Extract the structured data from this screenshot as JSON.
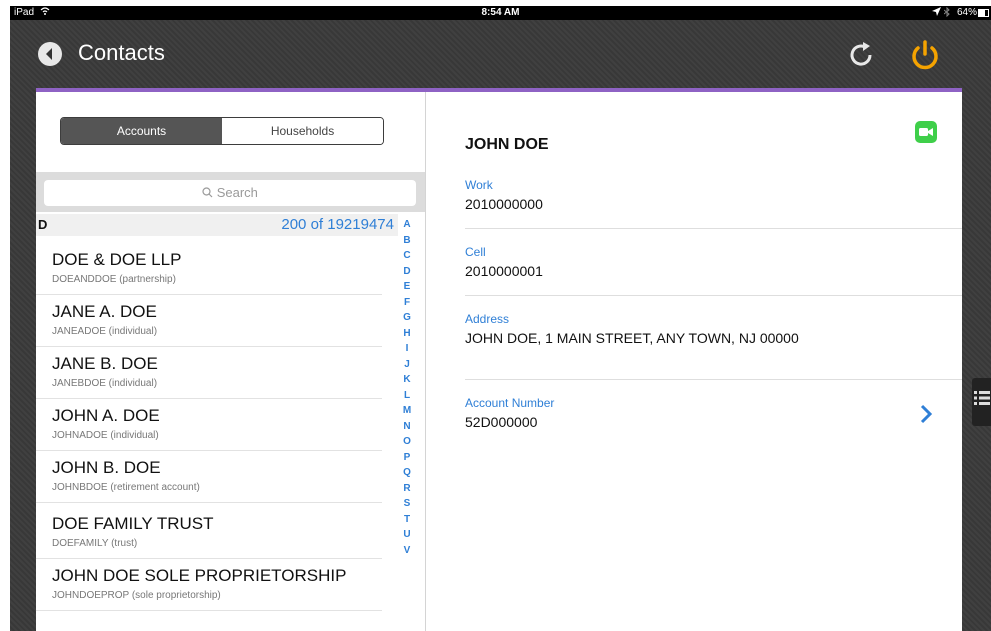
{
  "status": {
    "device": "iPad",
    "time": "8:54 AM",
    "battery": "64%",
    "battery_level": 0.64
  },
  "nav": {
    "title": "Contacts",
    "back_icon": "back-arrow-icon",
    "refresh_icon": "refresh-icon",
    "power_icon": "power-icon",
    "accent_color": "#8e62c4",
    "power_color": "#f5a300"
  },
  "segments": {
    "accounts": "Accounts",
    "households": "Households",
    "selected": "Accounts"
  },
  "search": {
    "placeholder": "Search"
  },
  "section": {
    "letter": "D",
    "count": "200 of 19219474"
  },
  "contacts": [
    {
      "name": "DOE & DOE LLP",
      "sub": "DOEANDDOE (partnership)"
    },
    {
      "name": "JANE A. DOE",
      "sub": "JANEADOE (individual)"
    },
    {
      "name": "JANE B. DOE",
      "sub": "JANEBDOE (individual)"
    },
    {
      "name": "JOHN A. DOE",
      "sub": "JOHNADOE (individual)"
    },
    {
      "name": "JOHN B. DOE",
      "sub": "JOHNBDOE (retirement account)"
    },
    {
      "name": "DOE FAMILY TRUST",
      "sub": "DOEFAMILY (trust)"
    },
    {
      "name": "JOHN DOE SOLE PROPRIETORSHIP",
      "sub": "JOHNDOEPROP (sole proprietorship)"
    }
  ],
  "index_letters": [
    "A",
    "B",
    "C",
    "D",
    "E",
    "F",
    "G",
    "H",
    "I",
    "J",
    "K",
    "L",
    "M",
    "N",
    "O",
    "P",
    "Q",
    "R",
    "S",
    "T",
    "U",
    "V"
  ],
  "detail": {
    "name": "JOHN DOE",
    "work_label": "Work",
    "work_value": "2010000000",
    "cell_label": "Cell",
    "cell_value": "2010000001",
    "address_label": "Address",
    "address_value": "JOHN DOE, 1 MAIN STREET, ANY TOWN, NJ 00000",
    "account_label": "Account Number",
    "account_value": "52D000000"
  }
}
